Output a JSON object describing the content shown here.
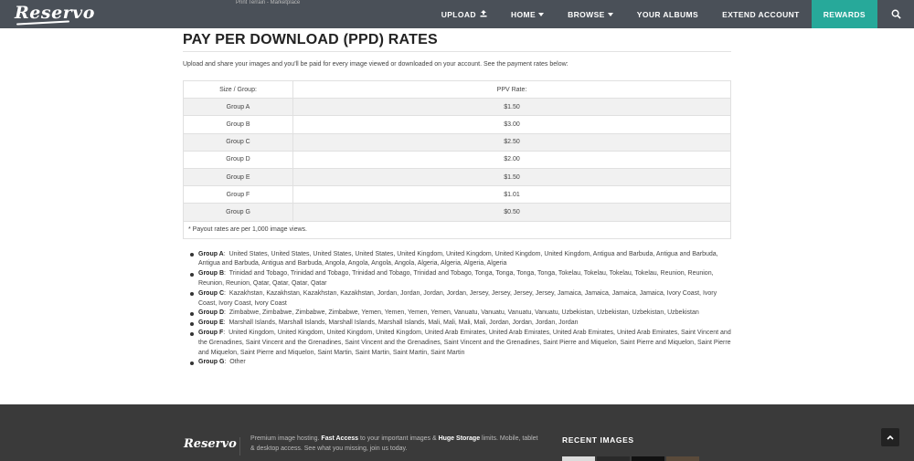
{
  "brand": {
    "logo": "Reservo"
  },
  "header": {
    "faint_text": "Print Terrain - Marketplace",
    "nav": [
      {
        "label": "UPLOAD",
        "icon": "upload-icon"
      },
      {
        "label": "HOME",
        "icon": "caret-down-icon"
      },
      {
        "label": "BROWSE",
        "icon": "caret-down-icon"
      },
      {
        "label": "YOUR ALBUMS"
      },
      {
        "label": "EXTEND ACCOUNT"
      },
      {
        "label": "REWARDS",
        "active_color": "#27a99a"
      }
    ],
    "search_icon": "search-icon"
  },
  "main": {
    "title": "PAY PER DOWNLOAD (PPD) RATES",
    "intro": "Upload and share your images and you'll be paid for every image viewed or downloaded on your account. See the payment rates below:",
    "table": {
      "headers": [
        "Size / Group:",
        "PPV Rate:"
      ],
      "rows": [
        {
          "group": "Group A",
          "rate": "$1.50"
        },
        {
          "group": "Group B",
          "rate": "$3.00"
        },
        {
          "group": "Group C",
          "rate": "$2.50"
        },
        {
          "group": "Group D",
          "rate": "$2.00"
        },
        {
          "group": "Group E",
          "rate": "$1.50"
        },
        {
          "group": "Group F",
          "rate": "$1.01"
        },
        {
          "group": "Group G",
          "rate": "$0.50"
        }
      ],
      "note": "* Payout rates are per 1,000 image views."
    },
    "groups": [
      {
        "label": "Group A",
        "countries": "United States, United States, United States, United States, United Kingdom, United Kingdom, United Kingdom, United Kingdom, Antigua and Barbuda, Antigua and Barbuda, Antigua and Barbuda, Antigua and Barbuda, Angola, Angola, Angola, Angola, Algeria, Algeria, Algeria, Algeria"
      },
      {
        "label": "Group B",
        "countries": "Trinidad and Tobago, Trinidad and Tobago, Trinidad and Tobago, Trinidad and Tobago, Tonga, Tonga, Tonga, Tonga, Tokelau, Tokelau, Tokelau, Tokelau, Reunion, Reunion, Reunion, Reunion, Qatar, Qatar, Qatar, Qatar"
      },
      {
        "label": "Group C",
        "countries": "Kazakhstan, Kazakhstan, Kazakhstan, Kazakhstan, Jordan, Jordan, Jordan, Jordan, Jersey, Jersey, Jersey, Jersey, Jamaica, Jamaica, Jamaica, Jamaica, Ivory Coast, Ivory Coast, Ivory Coast, Ivory Coast"
      },
      {
        "label": "Group D",
        "countries": "Zimbabwe, Zimbabwe, Zimbabwe, Zimbabwe, Yemen, Yemen, Yemen, Yemen, Vanuatu, Vanuatu, Vanuatu, Vanuatu, Uzbekistan, Uzbekistan, Uzbekistan, Uzbekistan"
      },
      {
        "label": "Group E",
        "countries": "Marshall Islands, Marshall Islands, Marshall Islands, Marshall Islands, Mali, Mali, Mali, Mali, Jordan, Jordan, Jordan, Jordan"
      },
      {
        "label": "Group F",
        "countries": "United Kingdom, United Kingdom, United Kingdom, United Kingdom, United Arab Emirates, United Arab Emirates, United Arab Emirates, United Arab Emirates, Saint Vincent and the Grenadines, Saint Vincent and the Grenadines, Saint Vincent and the Grenadines, Saint Vincent and the Grenadines, Saint Pierre and Miquelon, Saint Pierre and Miquelon, Saint Pierre and Miquelon, Saint Pierre and Miquelon, Saint Martin, Saint Martin, Saint Martin, Saint Martin"
      },
      {
        "label": "Group G",
        "countries": "Other"
      }
    ]
  },
  "footer": {
    "logo": "Reservo",
    "text_parts": [
      "Premium image hosting. ",
      "Fast Access",
      " to your important images & ",
      "Huge Storage",
      " limits. Mobile, tablet & desktop access. See what you missing, join us today."
    ],
    "recent_title": "RECENT IMAGES",
    "thumb_colors": [
      "#dcdcdc",
      "#2a2a2a",
      "#111111",
      "#5a4a3a"
    ],
    "scroll_top_icon": "chevron-up-icon"
  }
}
